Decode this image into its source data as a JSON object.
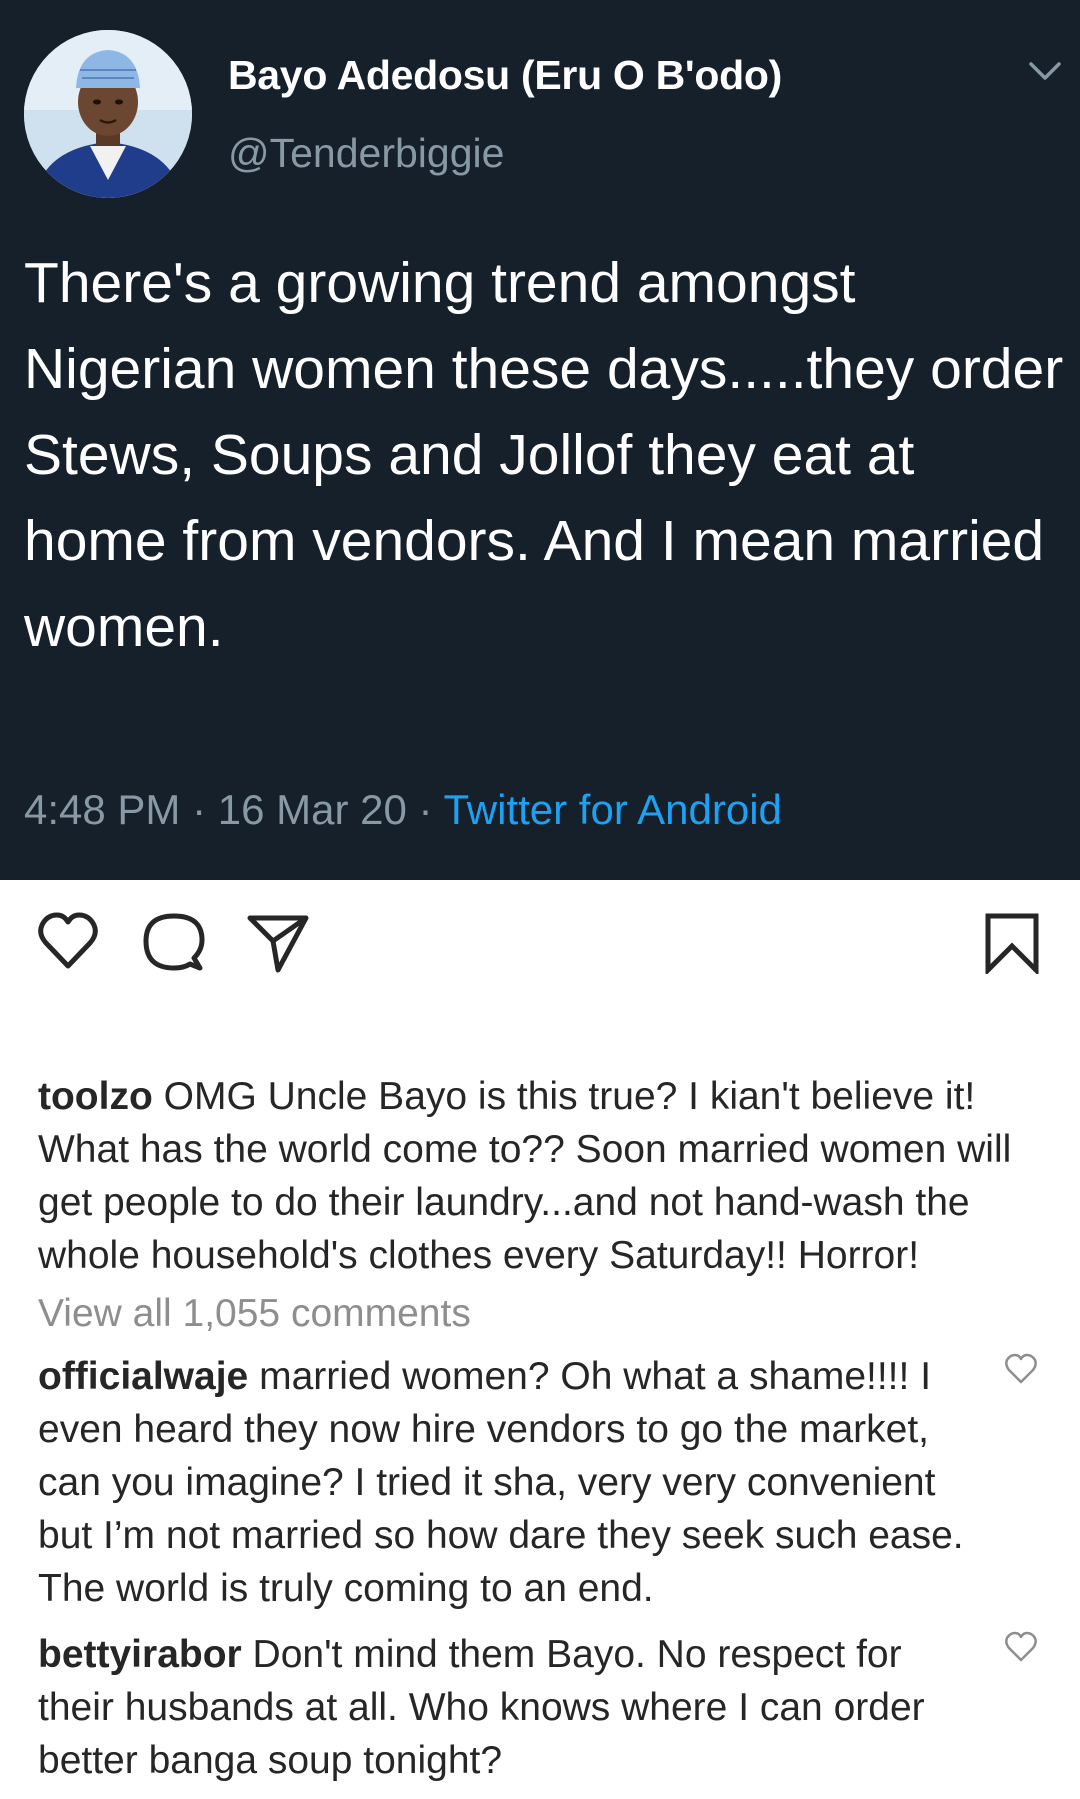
{
  "tweet": {
    "display_name": "Bayo Adedosu (Eru O B'odo)",
    "handle": "@Tenderbiggie",
    "text": "There's a growing trend amongst Nigerian women these days.....they order Stews, Soups and Jollof they eat at home from vendors. And I mean married women.",
    "time": "4:48 PM",
    "date": "16 Mar 20",
    "source": "Twitter for Android",
    "menu_icon": "chevron-down-icon",
    "colors": {
      "background": "#15202b",
      "secondary_text": "#8899a6",
      "link": "#1da1f2"
    }
  },
  "actions": {
    "icons": [
      "heart-icon",
      "comment-icon",
      "share-icon",
      "bookmark-icon"
    ]
  },
  "comments": {
    "first": {
      "user": "toolzo",
      "text": "OMG Uncle Bayo is this true? I kian't believe it! What has the world come to?? Soon married women will get people to do their laundry...and not hand-wash the whole household's clothes every Saturday!! Horror!"
    },
    "view_all": "View all 1,055 comments",
    "second": {
      "user": "officialwaje",
      "text": "married women? Oh what a shame!!!! I even heard they now hire vendors to go the market, can you imagine? I tried  it sha, very very convenient but I’m not married so how dare they seek such ease. The world is truly coming to an end."
    },
    "third": {
      "user": "bettyirabor",
      "text": "Don't mind them Bayo. No respect for their husbands at all. Who knows where I can order better banga soup tonight?"
    }
  }
}
